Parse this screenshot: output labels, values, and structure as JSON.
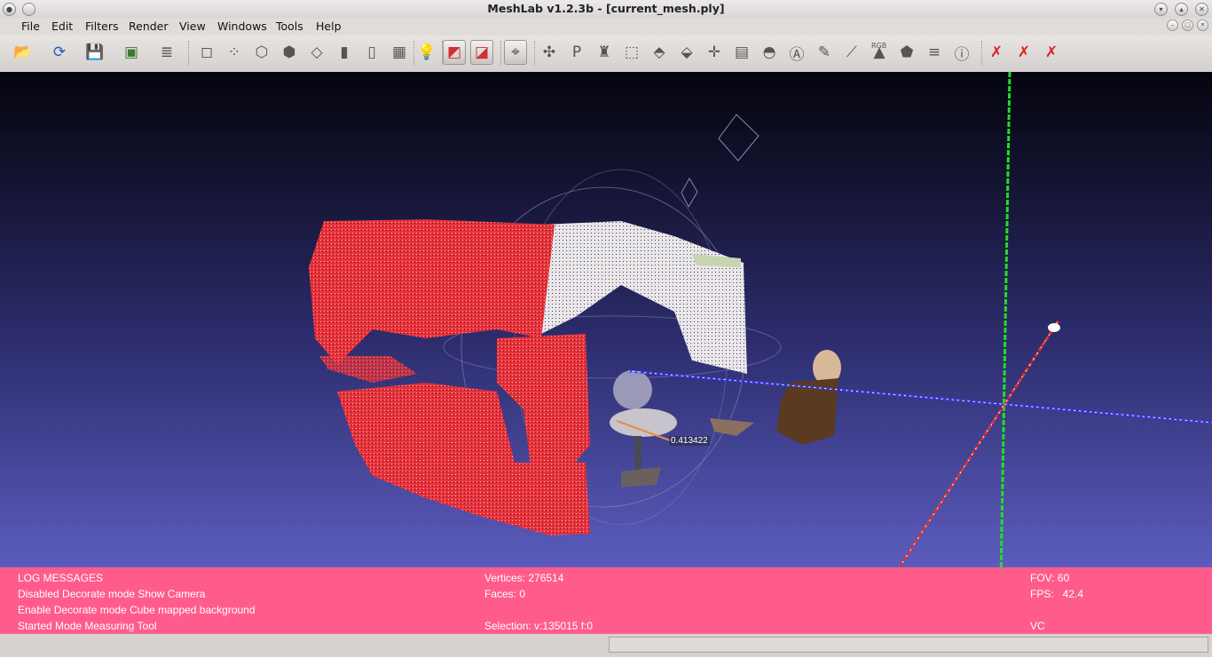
{
  "window": {
    "title": "MeshLab v1.2.3b - [current_mesh.ply]"
  },
  "menu": [
    "File",
    "Edit",
    "Filters",
    "Render",
    "View",
    "Windows",
    "Tools",
    "Help"
  ],
  "toolbar_icons": [
    {
      "name": "open-icon",
      "glyph": "📂"
    },
    {
      "name": "reload-icon",
      "glyph": "⟳"
    },
    {
      "name": "save-icon",
      "glyph": "💾"
    },
    {
      "name": "snapshot-icon",
      "glyph": "▣"
    },
    {
      "name": "layers-icon",
      "glyph": "≣"
    },
    {
      "name": "bbox-icon",
      "glyph": "◻"
    },
    {
      "name": "points-icon",
      "glyph": "⁘"
    },
    {
      "name": "wireframe-icon",
      "glyph": "⬡"
    },
    {
      "name": "hidden-lines-icon",
      "glyph": "⬢"
    },
    {
      "name": "flat-lines-icon",
      "glyph": "◇"
    },
    {
      "name": "flat-icon",
      "glyph": "▮"
    },
    {
      "name": "smooth-icon",
      "glyph": "▯"
    },
    {
      "name": "texture-icon",
      "glyph": "▦"
    },
    {
      "name": "light-icon",
      "glyph": "💡"
    },
    {
      "name": "backface-icon",
      "glyph": "◩"
    },
    {
      "name": "double-side-icon",
      "glyph": "◪"
    },
    {
      "name": "select-faces-icon",
      "glyph": "⌖"
    },
    {
      "name": "select-vertices-icon",
      "glyph": "✣"
    },
    {
      "name": "paint-icon",
      "glyph": "P"
    },
    {
      "name": "quality-icon",
      "glyph": "♜"
    },
    {
      "name": "select-connected-icon",
      "glyph": "⬚"
    },
    {
      "name": "mesh-select-icon",
      "glyph": "⬘"
    },
    {
      "name": "align-icon",
      "glyph": "⬙"
    },
    {
      "name": "measure-icon",
      "glyph": "✛"
    },
    {
      "name": "texture-edit-icon",
      "glyph": "▤"
    },
    {
      "name": "fill-icon",
      "glyph": "◓"
    },
    {
      "name": "annotation-icon",
      "glyph": "Ⓐ"
    },
    {
      "name": "z-paint-icon",
      "glyph": "✎"
    },
    {
      "name": "brush-icon",
      "glyph": "⟋"
    },
    {
      "name": "rgb-icon",
      "glyph": "▲"
    },
    {
      "name": "sculpt-icon",
      "glyph": "⬟"
    },
    {
      "name": "stack-icon",
      "glyph": "≡"
    },
    {
      "name": "info-icon",
      "glyph": "ⓘ"
    },
    {
      "name": "delete-vertices-icon",
      "glyph": "✗"
    },
    {
      "name": "delete-faces-icon",
      "glyph": "✗"
    },
    {
      "name": "delete-all-icon",
      "glyph": "✗"
    }
  ],
  "rgb_label": "RGB",
  "measure_label": "0.413422",
  "log": {
    "title": "LOG MESSAGES",
    "lines": [
      "Disabled Decorate mode Show Camera",
      "Enable Decorate mode Cube mapped background",
      "Started Mode Measuring Tool"
    ]
  },
  "mesh_info": {
    "vertices": "Vertices: 276514",
    "faces": "Faces: 0",
    "selection": "Selection: v:135015 f:0"
  },
  "render_info": {
    "fov": "FOV: 60",
    "fps": "FPS:   42.4",
    "mode": "VC"
  },
  "colors": {
    "log_bg": "#ff5c8c",
    "x_axis": "#e03030",
    "y_axis": "#20e020",
    "z_axis": "#2020ff",
    "mesh_red": "#e8323a"
  }
}
